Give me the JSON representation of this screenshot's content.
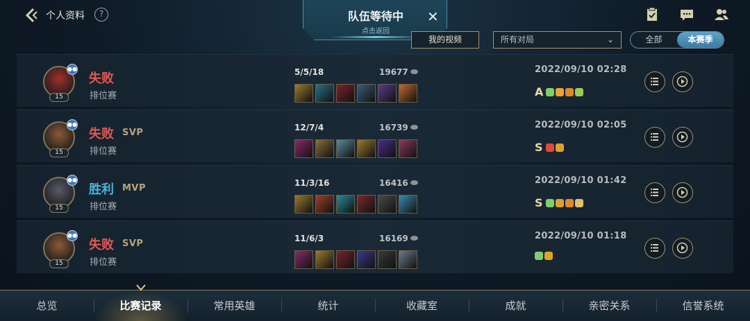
{
  "header": {
    "title": "个人资料",
    "help": "?"
  },
  "queue": {
    "title": "队伍等待中",
    "subtitle": "点击返回",
    "close": "✕"
  },
  "filters": {
    "my_videos": "我的视频",
    "match_filter": "所有对局",
    "toggle": [
      "全部",
      "本赛季"
    ],
    "toggle_selected": "本赛季"
  },
  "matches": [
    {
      "result": "失败",
      "outcome": "lose",
      "badge": "",
      "mode": "排位赛",
      "level": "15",
      "kda": "5/5/18",
      "gold": "19677",
      "datetime": "2022/09/10 02:28",
      "grade": "A",
      "items": [
        "#9b7a2e",
        "#2d6f86",
        "#7a2430",
        "#3d5b78",
        "#5a3a8a",
        "#c06a2a"
      ],
      "honors": [
        "#7fcf6a",
        "#f0a030",
        "#e08a2a",
        "#9ccb5a"
      ],
      "avatar_color": "#a0302e"
    },
    {
      "result": "失败",
      "outcome": "lose",
      "badge": "SVP",
      "mode": "排位赛",
      "level": "15",
      "kda": "12/7/4",
      "gold": "16739",
      "datetime": "2022/09/10 02:05",
      "grade": "S",
      "items": [
        "#8a2a6a",
        "#8a6d3a",
        "#5a8aa0",
        "#9b7a2e",
        "#4a2a8a",
        "#8a3a5a"
      ],
      "honors": [
        "#e04a3a",
        "#e0a030"
      ],
      "avatar_color": "#8a5a3a"
    },
    {
      "result": "胜利",
      "outcome": "win",
      "badge": "MVP",
      "mode": "排位赛",
      "level": "15",
      "kda": "11/3/16",
      "gold": "16416",
      "datetime": "2022/09/10 01:42",
      "grade": "S",
      "items": [
        "#9b7a2e",
        "#a0402a",
        "#2a8a9a",
        "#7a2a2a",
        "#4a4a4a",
        "#3a8aaa"
      ],
      "honors": [
        "#7fcf6a",
        "#e0a030",
        "#e08a2a",
        "#e0c070"
      ],
      "avatar_color": "#5a5a6a"
    },
    {
      "result": "失败",
      "outcome": "lose",
      "badge": "SVP",
      "mode": "排位赛",
      "level": "15",
      "kda": "11/6/3",
      "gold": "16169",
      "datetime": "2022/09/10 01:18",
      "grade": "",
      "items": [
        "#8a2a6a",
        "#9b7a2e",
        "#7a2430",
        "#3a3a8a",
        "#3a3a3a",
        "#6a7a8a"
      ],
      "honors": [
        "#7fcf6a",
        "#e0a030"
      ],
      "avatar_color": "#8a5a3a"
    }
  ],
  "nav": {
    "items": [
      "总览",
      "比赛记录",
      "常用英雄",
      "统计",
      "收藏室",
      "成就",
      "亲密关系",
      "信誉系统"
    ],
    "active_index": 1
  },
  "colors": {
    "lose": "#e05a55",
    "win": "#4ab5dd",
    "gold_border": "#a49572",
    "toggle_active": "#4a8db6"
  }
}
